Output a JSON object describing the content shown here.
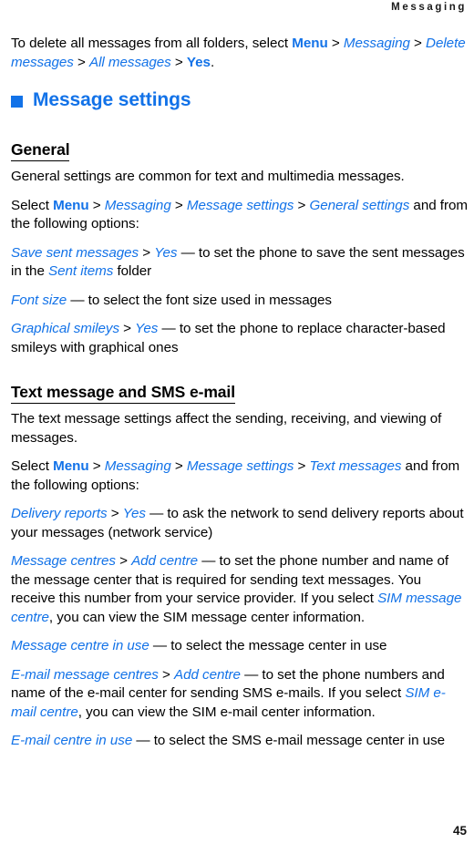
{
  "header": {
    "running_head": "Messaging"
  },
  "chapter": {
    "bullet_color": "#1272e8",
    "title": "Message settings"
  },
  "colors": {
    "link_blue": "#1272e8",
    "text_black": "#000000"
  },
  "intro": {
    "p1": {
      "lead": "To delete all messages from all folders, select ",
      "menu": "Menu",
      "sep": " > ",
      "path1": "Messaging",
      "path2": "Delete messages",
      "path3": "All messages",
      "path4": "Yes",
      "tail": "."
    }
  },
  "sections": [
    {
      "heading": "General",
      "paragraphs": {
        "intro": "General settings are common for text and multimedia messages.",
        "select_lead": "Select ",
        "menu": "Menu",
        "sep": " > ",
        "path1": "Messaging",
        "path2": "Message settings",
        "path3": "General settings",
        "select_tail": " and from the following options:",
        "opt1_term": "Save sent messages",
        "opt1_value": "Yes",
        "opt1_desc_a": " — to set the phone to save the sent messages in the ",
        "opt1_folder": "Sent items",
        "opt1_desc_b": " folder",
        "opt2_term": "Font size",
        "opt2_desc": " — to select the font size used in messages",
        "opt3_term": "Graphical smileys",
        "opt3_value": "Yes",
        "opt3_desc": " — to set the phone to replace character-based smileys with graphical ones"
      }
    },
    {
      "heading": "Text message and SMS e-mail",
      "paragraphs": {
        "intro": "The text message settings affect the sending, receiving, and viewing of messages.",
        "select_lead": "Select ",
        "menu": "Menu",
        "sep": " > ",
        "path1": "Messaging",
        "path2": "Message settings",
        "path3": "Text messages",
        "select_tail": " and from the following options:",
        "opt1_term": "Delivery reports",
        "opt1_value": "Yes",
        "opt1_desc": " — to ask the network to send delivery reports about your messages (network service)",
        "opt2_term": "Message centres",
        "opt2_value": "Add centre",
        "opt2_desc_a": " — to set the phone number and name of the message center that is required for sending text messages. You receive this number from your service provider. If you select ",
        "opt2_ref": "SIM message centre",
        "opt2_desc_b": ", you can view the SIM message center information.",
        "opt3_term": "Message centre in use",
        "opt3_desc": " — to select the message center in use",
        "opt4_term": "E-mail message centres",
        "opt4_value": "Add centre",
        "opt4_desc_a": " — to set the phone numbers and name of the e-mail center for sending SMS e-mails. If you select ",
        "opt4_ref": "SIM e-mail centre",
        "opt4_desc_b": ", you can view the SIM e-mail center information.",
        "opt5_term": "E-mail centre in use",
        "opt5_desc": " — to select the SMS e-mail message center in use"
      }
    }
  ],
  "footer": {
    "page_number": "45"
  }
}
